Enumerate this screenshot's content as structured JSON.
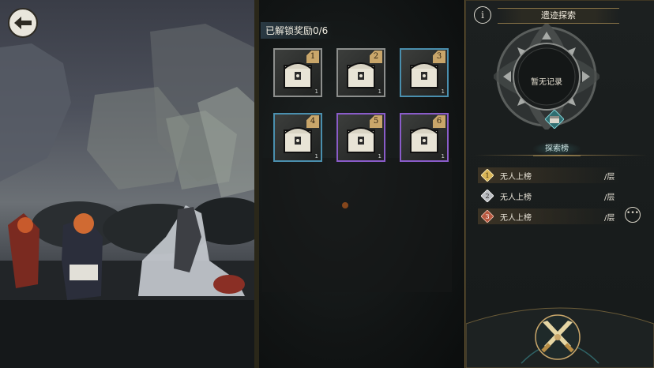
{
  "rewards": {
    "title": "已解锁奖励0/6",
    "chests": [
      {
        "num": "1",
        "count": "1",
        "border": "#8d8f8d"
      },
      {
        "num": "2",
        "count": "1",
        "border": "#8d8f8d"
      },
      {
        "num": "3",
        "count": "1",
        "border": "#4a8fae"
      },
      {
        "num": "4",
        "count": "1",
        "border": "#4a8fae"
      },
      {
        "num": "5",
        "count": "1",
        "border": "#8a5cc9"
      },
      {
        "num": "6",
        "count": "1",
        "border": "#8a5cc9"
      }
    ]
  },
  "panel": {
    "title": "遗迹探索",
    "info_icon": "i",
    "no_record": "暂无记录",
    "rank_tab": "探索榜",
    "rankings": [
      {
        "rank": "1",
        "name": "无人上榜",
        "unit": "/层",
        "badge_color": "#d8b456"
      },
      {
        "rank": "2",
        "name": "无人上榜",
        "unit": "/层",
        "badge_color": "#b9bcc0"
      },
      {
        "rank": "3",
        "name": "无人上榜",
        "unit": "/层",
        "badge_color": "#b8583f"
      }
    ],
    "more_icon": "•••"
  },
  "icons": {
    "back": "back-arrow-icon",
    "explore": "crossed-swords-icon"
  },
  "colors": {
    "gold": "#c9a66a",
    "accent_teal": "#3c8f95"
  }
}
